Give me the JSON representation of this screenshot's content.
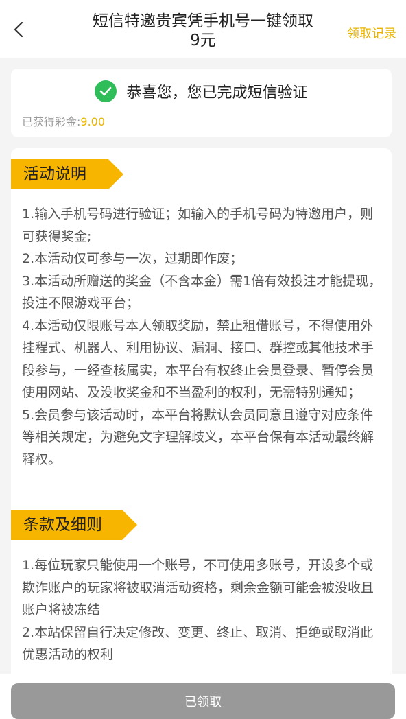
{
  "header": {
    "title_line1": "短信特邀贵宾凭手机号一键领取",
    "title_line2": "9元",
    "right_link": "领取记录",
    "back_icon": "chevron-left-icon"
  },
  "verify": {
    "icon": "check-circle-icon",
    "message": "恭喜您，您已完成短信验证",
    "bonus_label": "已获得彩金:",
    "bonus_value": "9.00"
  },
  "activity": {
    "title": "活动说明",
    "rules": [
      "1.输入手机号码进行验证；如输入的手机号码为特邀用户，则可获得奖金;",
      "2.本活动仅可参与一次，过期即作废；",
      "3.本活动所赠送的奖金（不含本金）需1倍有效投注才能提现，投注不限游戏平台；",
      "4.本活动仅限账号本人领取奖励，禁止租借账号，不得使用外挂程式、机器人、利用协议、漏洞、接口、群控或其他技术手段参与，一经查核属实，本平台有权终止会员登录、暂停会员使用网站、及没收奖金和不当盈利的权利，无需特别通知；",
      "5.会员参与该活动时，本平台将默认会员同意且遵守对应条件等相关规定，为避免文字理解歧义，本平台保有本活动最终解释权。"
    ]
  },
  "terms": {
    "title": "条款及细则",
    "rules": [
      "1.每位玩家只能使用一个账号，不可使用多账号，开设多个或欺诈账户的玩家将被取消活动资格，剩余金额可能会被没收且账户将被冻结",
      "2.本站保留自行决定修改、变更、终止、取消、拒绝或取消此优惠活动的权利"
    ]
  },
  "footer": {
    "button_label": "已领取"
  },
  "colors": {
    "accent": "#e9b400",
    "tag": "#f7b500",
    "success": "#2ebd59",
    "disabled_button": "#999999"
  }
}
